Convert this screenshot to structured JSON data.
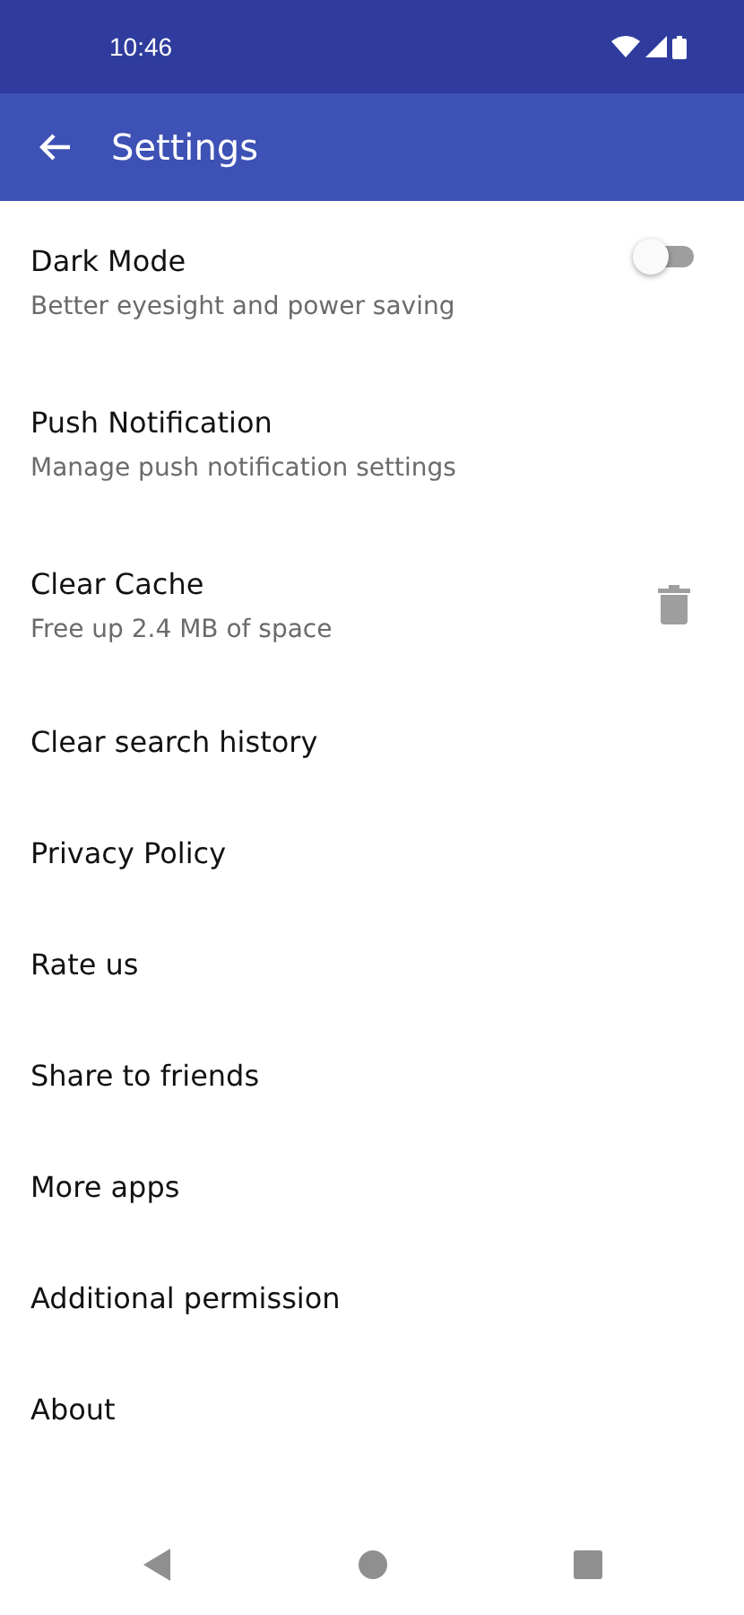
{
  "status_bar": {
    "time": "10:46"
  },
  "app_bar": {
    "title": "Settings"
  },
  "items": [
    {
      "kind": "toggle",
      "title": "Dark Mode",
      "subtitle": "Better eyesight and power saving",
      "on": false
    },
    {
      "kind": "plain",
      "title": "Push Notification",
      "subtitle": "Manage push notification settings"
    },
    {
      "kind": "delete",
      "title": "Clear Cache",
      "subtitle": "Free up 2.4 MB of space"
    },
    {
      "kind": "plain",
      "title": "Clear search history"
    },
    {
      "kind": "plain",
      "title": "Privacy Policy"
    },
    {
      "kind": "plain",
      "title": "Rate us"
    },
    {
      "kind": "plain",
      "title": "Share to friends"
    },
    {
      "kind": "plain",
      "title": "More apps"
    },
    {
      "kind": "plain",
      "title": "Additional permission"
    },
    {
      "kind": "plain",
      "title": "About"
    }
  ]
}
